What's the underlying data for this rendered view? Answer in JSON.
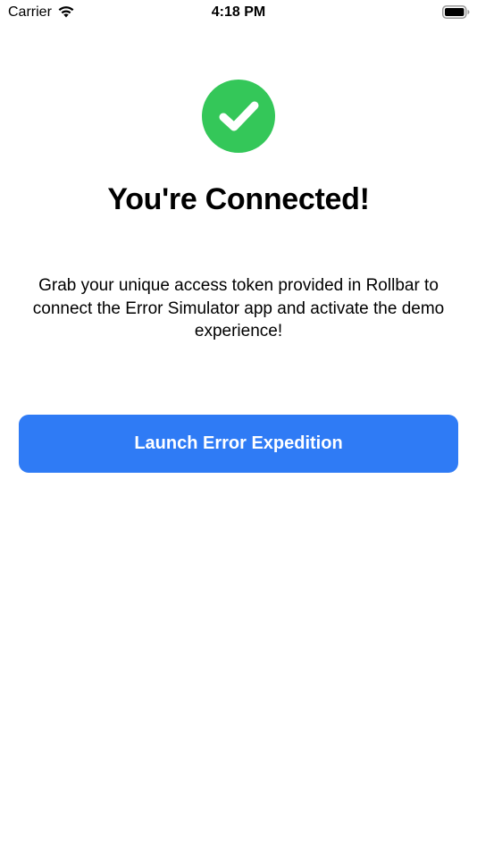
{
  "status_bar": {
    "carrier": "Carrier",
    "time": "4:18 PM",
    "wifi_icon": "wifi-icon",
    "battery_icon": "battery-icon"
  },
  "main": {
    "check_icon": "checkmark-circle-icon",
    "title": "You're Connected!",
    "description": "Grab your unique access token provided in Rollbar to connect the Error Simulator app and activate the demo experience!",
    "launch_button_label": "Launch Error Expedition"
  },
  "colors": {
    "success_green": "#34C759",
    "button_blue": "#2F7BF5"
  }
}
